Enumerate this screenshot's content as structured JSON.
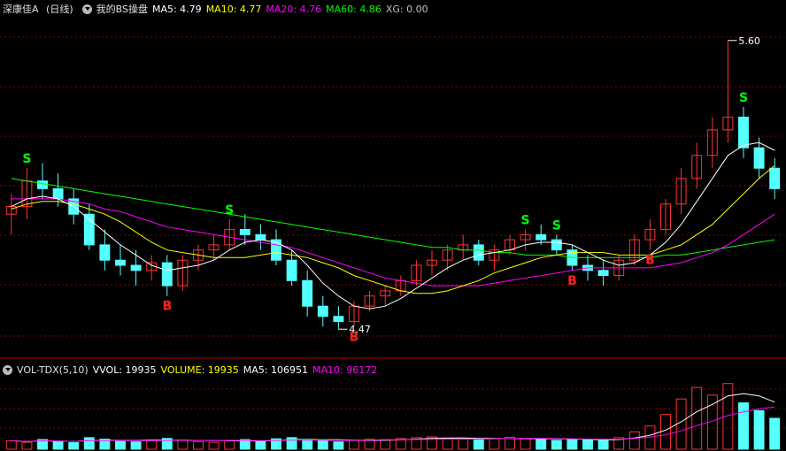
{
  "header": {
    "stock_name": "深康佳A",
    "period": "(日线)",
    "indicator_name": "我的BS操盘",
    "ma5": "MA5: 4.79",
    "ma10": "MA10: 4.77",
    "ma20": "MA20: 4.76",
    "ma60": "MA60: 4.86",
    "xg": "XG: 0.00"
  },
  "volume_header": {
    "indicator_name": "VOL-TDX(5,10)",
    "vvol": "VVOL: 19935",
    "volume": "VOLUME: 19935",
    "ma5": "MA5: 106951",
    "ma10": "MA10: 96172"
  },
  "colors": {
    "up": "#ff3232",
    "down": "#54ffff",
    "ma5": "#ffffff",
    "ma10": "#ffff00",
    "ma20": "#ff00ff",
    "ma60": "#00ff00",
    "signal_b": "#ff2020",
    "signal_s": "#00ff00",
    "grid": "#8b0000"
  },
  "price_annotations": {
    "high": "5.60",
    "low": "4.47"
  },
  "chart_data": {
    "type": "candlestick",
    "period": "daily",
    "ohlc": [
      [
        4.92,
        5.0,
        4.84,
        4.95
      ],
      [
        4.95,
        5.1,
        4.9,
        5.05
      ],
      [
        5.05,
        5.12,
        4.98,
        5.02
      ],
      [
        5.02,
        5.08,
        4.95,
        4.98
      ],
      [
        4.98,
        5.02,
        4.88,
        4.92
      ],
      [
        4.92,
        4.96,
        4.78,
        4.8
      ],
      [
        4.8,
        4.86,
        4.7,
        4.74
      ],
      [
        4.74,
        4.8,
        4.68,
        4.72
      ],
      [
        4.72,
        4.78,
        4.64,
        4.7
      ],
      [
        4.7,
        4.76,
        4.66,
        4.73
      ],
      [
        4.73,
        4.76,
        4.6,
        4.64
      ],
      [
        4.64,
        4.76,
        4.62,
        4.74
      ],
      [
        4.74,
        4.8,
        4.7,
        4.78
      ],
      [
        4.78,
        4.84,
        4.74,
        4.8
      ],
      [
        4.8,
        4.9,
        4.78,
        4.86
      ],
      [
        4.86,
        4.92,
        4.8,
        4.84
      ],
      [
        4.84,
        4.88,
        4.78,
        4.82
      ],
      [
        4.82,
        4.86,
        4.72,
        4.74
      ],
      [
        4.74,
        4.78,
        4.64,
        4.66
      ],
      [
        4.66,
        4.7,
        4.52,
        4.56
      ],
      [
        4.56,
        4.6,
        4.48,
        4.52
      ],
      [
        4.52,
        4.56,
        4.47,
        4.5
      ],
      [
        4.5,
        4.58,
        4.48,
        4.56
      ],
      [
        4.56,
        4.62,
        4.54,
        4.6
      ],
      [
        4.6,
        4.64,
        4.56,
        4.62
      ],
      [
        4.62,
        4.68,
        4.6,
        4.66
      ],
      [
        4.66,
        4.74,
        4.64,
        4.72
      ],
      [
        4.72,
        4.78,
        4.68,
        4.74
      ],
      [
        4.74,
        4.8,
        4.7,
        4.78
      ],
      [
        4.78,
        4.84,
        4.74,
        4.8
      ],
      [
        4.8,
        4.82,
        4.72,
        4.74
      ],
      [
        4.74,
        4.8,
        4.7,
        4.78
      ],
      [
        4.78,
        4.84,
        4.76,
        4.82
      ],
      [
        4.82,
        4.86,
        4.78,
        4.84
      ],
      [
        4.84,
        4.88,
        4.8,
        4.82
      ],
      [
        4.82,
        4.84,
        4.76,
        4.78
      ],
      [
        4.78,
        4.8,
        4.7,
        4.72
      ],
      [
        4.72,
        4.76,
        4.66,
        4.7
      ],
      [
        4.7,
        4.74,
        4.64,
        4.68
      ],
      [
        4.68,
        4.76,
        4.66,
        4.74
      ],
      [
        4.74,
        4.84,
        4.72,
        4.82
      ],
      [
        4.82,
        4.9,
        4.78,
        4.86
      ],
      [
        4.86,
        4.98,
        4.84,
        4.96
      ],
      [
        4.96,
        5.1,
        4.92,
        5.06
      ],
      [
        5.06,
        5.2,
        5.02,
        5.15
      ],
      [
        5.15,
        5.3,
        5.1,
        5.25
      ],
      [
        5.25,
        5.6,
        5.2,
        5.3
      ],
      [
        5.3,
        5.34,
        5.14,
        5.18
      ],
      [
        5.18,
        5.22,
        5.06,
        5.1
      ],
      [
        5.1,
        5.14,
        4.98,
        5.02
      ]
    ],
    "volume": [
      22000,
      18000,
      25000,
      20000,
      17000,
      30000,
      26000,
      21000,
      19000,
      23000,
      28000,
      24000,
      20000,
      18000,
      22000,
      25000,
      21000,
      27000,
      30000,
      24000,
      22000,
      19000,
      23000,
      26000,
      25000,
      28000,
      30000,
      32000,
      29000,
      26000,
      24000,
      27000,
      31000,
      28000,
      25000,
      23000,
      26000,
      24000,
      22000,
      30000,
      45000,
      60000,
      90000,
      130000,
      160000,
      140000,
      170000,
      120000,
      100000,
      80000
    ],
    "ma5": [
      4.95,
      4.98,
      4.99,
      4.98,
      4.95,
      4.9,
      4.85,
      4.8,
      4.76,
      4.72,
      4.7,
      4.71,
      4.72,
      4.74,
      4.78,
      4.81,
      4.82,
      4.81,
      4.78,
      4.72,
      4.65,
      4.6,
      4.56,
      4.55,
      4.56,
      4.59,
      4.63,
      4.67,
      4.71,
      4.74,
      4.76,
      4.77,
      4.78,
      4.8,
      4.81,
      4.81,
      4.8,
      4.77,
      4.74,
      4.72,
      4.73,
      4.76,
      4.81,
      4.88,
      4.97,
      5.06,
      5.15,
      5.19,
      5.2,
      5.17
    ],
    "ma10": [
      4.94,
      4.96,
      4.97,
      4.97,
      4.96,
      4.94,
      4.92,
      4.89,
      4.85,
      4.81,
      4.78,
      4.77,
      4.76,
      4.75,
      4.75,
      4.75,
      4.76,
      4.77,
      4.76,
      4.75,
      4.73,
      4.71,
      4.68,
      4.66,
      4.64,
      4.62,
      4.61,
      4.61,
      4.62,
      4.64,
      4.66,
      4.69,
      4.71,
      4.73,
      4.75,
      4.76,
      4.77,
      4.77,
      4.77,
      4.76,
      4.76,
      4.76,
      4.78,
      4.8,
      4.84,
      4.88,
      4.94,
      5.0,
      5.06,
      5.11
    ],
    "ma20": [
      4.98,
      4.98,
      4.98,
      4.98,
      4.97,
      4.96,
      4.94,
      4.93,
      4.91,
      4.89,
      4.87,
      4.86,
      4.85,
      4.84,
      4.83,
      4.82,
      4.81,
      4.8,
      4.79,
      4.77,
      4.75,
      4.73,
      4.71,
      4.69,
      4.67,
      4.66,
      4.65,
      4.64,
      4.64,
      4.64,
      4.64,
      4.65,
      4.66,
      4.67,
      4.68,
      4.69,
      4.7,
      4.71,
      4.71,
      4.71,
      4.71,
      4.71,
      4.72,
      4.73,
      4.75,
      4.77,
      4.8,
      4.84,
      4.88,
      4.92
    ],
    "ma60": [
      5.06,
      5.05,
      5.04,
      5.03,
      5.02,
      5.01,
      5.0,
      4.99,
      4.98,
      4.97,
      4.96,
      4.95,
      4.94,
      4.93,
      4.92,
      4.91,
      4.9,
      4.89,
      4.88,
      4.87,
      4.86,
      4.85,
      4.84,
      4.83,
      4.82,
      4.81,
      4.8,
      4.79,
      4.79,
      4.78,
      4.78,
      4.77,
      4.77,
      4.76,
      4.76,
      4.76,
      4.75,
      4.75,
      4.75,
      4.75,
      4.75,
      4.75,
      4.76,
      4.76,
      4.77,
      4.78,
      4.79,
      4.8,
      4.81,
      4.82
    ],
    "signals": [
      {
        "index": 1,
        "label": "S"
      },
      {
        "index": 10,
        "label": "B"
      },
      {
        "index": 14,
        "label": "S"
      },
      {
        "index": 22,
        "label": "B"
      },
      {
        "index": 33,
        "label": "S"
      },
      {
        "index": 35,
        "label": "S"
      },
      {
        "index": 36,
        "label": "B"
      },
      {
        "index": 41,
        "label": "B"
      },
      {
        "index": 47,
        "label": "S"
      }
    ]
  }
}
